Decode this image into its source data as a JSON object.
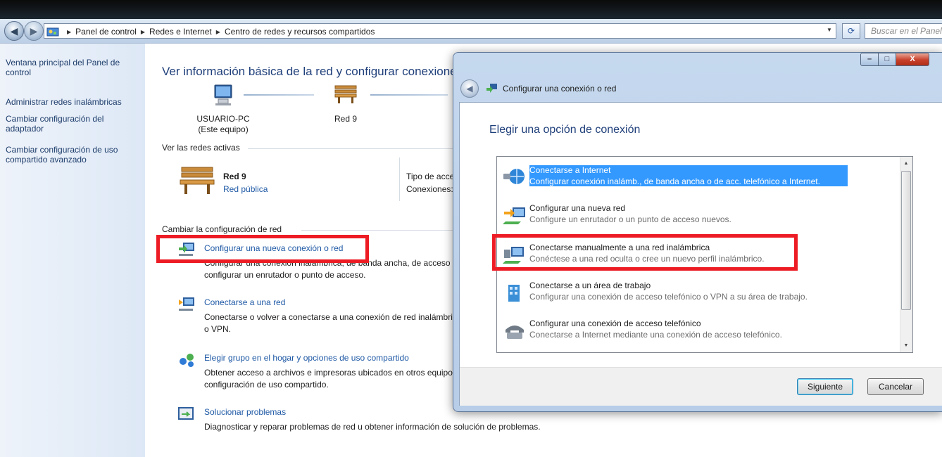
{
  "explorer": {
    "breadcrumb": [
      "Panel de control",
      "Redes e Internet",
      "Centro de redes y recursos compartidos"
    ],
    "search_placeholder": "Buscar en el Panel de control"
  },
  "sidebar": {
    "items": [
      {
        "label": "Ventana principal del Panel de control"
      },
      {
        "label": "Administrar redes inalámbricas"
      },
      {
        "label": "Cambiar configuración del adaptador"
      },
      {
        "label": "Cambiar configuración de uso compartido avanzado"
      }
    ]
  },
  "main": {
    "title": "Ver información básica de la red y configurar conexiones",
    "computer_name": "USUARIO-PC",
    "computer_sub": "(Este equipo)",
    "network_name": "Red 9",
    "active_networks_label": "Ver las redes activas",
    "active_network": {
      "name": "Red 9",
      "type_link": "Red pública"
    },
    "access_type_label": "Tipo de acceso:",
    "connections_label": "Conexiones:",
    "change_settings_label": "Cambiar la configuración de red",
    "tasks": [
      {
        "link": "Configurar una nueva conexión o red",
        "desc1": "Configurar una conexión inalámbrica, de banda ancha, de acceso telefónico, ad hoc o VPN; o bien,",
        "desc2": "configurar un enrutador o punto de acceso."
      },
      {
        "link": "Conectarse a una red",
        "desc1": "Conectarse o volver a conectarse a una conexión de red inalámbrica, cableada, de acceso telefónico",
        "desc2": "o VPN."
      },
      {
        "link": "Elegir grupo en el hogar y opciones de uso compartido",
        "desc1": "Obtener acceso a archivos e impresoras ubicados en otros equipos de la red o cambiar la",
        "desc2": "configuración de uso compartido."
      },
      {
        "link": "Solucionar problemas",
        "desc1": "Diagnosticar y reparar problemas de red u obtener información de solución de problemas.",
        "desc2": ""
      }
    ]
  },
  "dialog": {
    "title": "Configurar una conexión o red",
    "heading": "Elegir una opción de conexión",
    "options": [
      {
        "title": "Conectarse a Internet",
        "desc": "Configurar conexión inalámb., de banda ancha o de acc. telefónico a Internet.",
        "icon": "globe-icon"
      },
      {
        "title": "Configurar una nueva red",
        "desc": "Configure un enrutador o un punto de acceso nuevos.",
        "icon": "new-network-icon"
      },
      {
        "title": "Conectarse manualmente a una red inalámbrica",
        "desc": "Conéctese a una red oculta o cree un nuevo perfil inalámbrico.",
        "icon": "wireless-computer-icon"
      },
      {
        "title": "Conectarse a un área de trabajo",
        "desc": "Configurar una conexión de acceso telefónico o VPN a su área de trabajo.",
        "icon": "workplace-icon"
      },
      {
        "title": "Configurar una conexión de acceso telefónico",
        "desc": "Conectarse a Internet mediante una conexión de acceso telefónico.",
        "icon": "dialup-phone-icon"
      }
    ],
    "next_button": "Siguiente",
    "cancel_button": "Cancelar",
    "window_controls": {
      "minimize": "–",
      "maximize": "□",
      "close": "X"
    }
  },
  "colors": {
    "highlight": "#3399ff",
    "annotation_red": "#ed1c24",
    "link": "#1f59a5",
    "heading": "#1f3f7a"
  }
}
